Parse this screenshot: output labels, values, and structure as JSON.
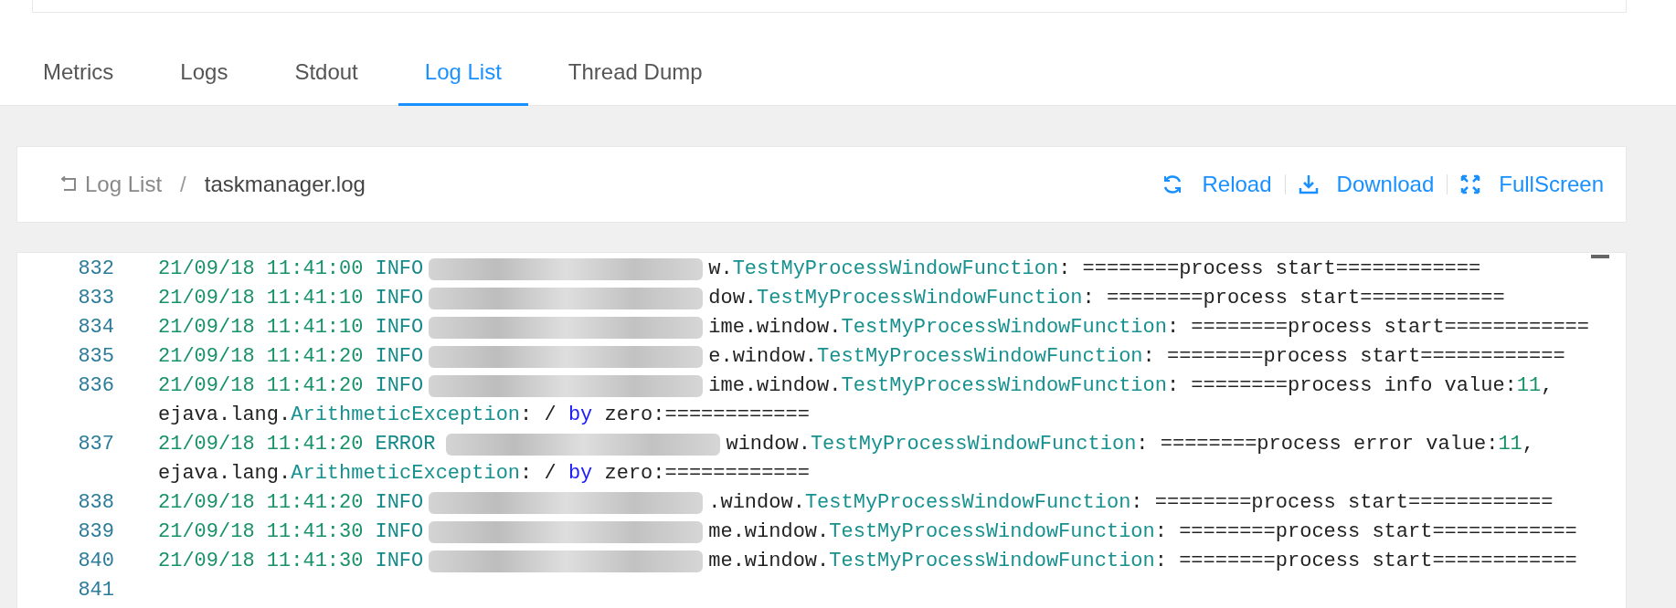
{
  "tabs": [
    {
      "label": "Metrics",
      "selected": false
    },
    {
      "label": "Logs",
      "selected": false
    },
    {
      "label": "Stdout",
      "selected": false
    },
    {
      "label": "Log List",
      "selected": true
    },
    {
      "label": "Thread Dump",
      "selected": false
    }
  ],
  "breadcrumb": {
    "back": "Log List",
    "separator": "/",
    "current": "taskmanager.log"
  },
  "actions": [
    {
      "kind": "reload",
      "label": "Reload"
    },
    {
      "kind": "download",
      "label": "Download"
    },
    {
      "kind": "fullscreen",
      "label": "FullScreen"
    }
  ],
  "log_lines": [
    {
      "number": "832",
      "timestamp": "21/09/18 11:41:00",
      "level": "INFO",
      "source_tail": "w.",
      "class_name": "TestMyProcessWindowFunction",
      "message": ": ========process start============"
    },
    {
      "number": "833",
      "timestamp": "21/09/18 11:41:10",
      "level": "INFO",
      "source_tail": "dow.",
      "class_name": "TestMyProcessWindowFunction",
      "message": ": ========process start============"
    },
    {
      "number": "834",
      "timestamp": "21/09/18 11:41:10",
      "level": "INFO",
      "source_tail": "ime.window.",
      "class_name": "TestMyProcessWindowFunction",
      "message": ": ========process start============"
    },
    {
      "number": "835",
      "timestamp": "21/09/18 11:41:20",
      "level": "INFO",
      "source_tail": "e.window.",
      "class_name": "TestMyProcessWindowFunction",
      "message": ": ========process start============"
    },
    {
      "number": "836",
      "timestamp": "21/09/18 11:41:20",
      "level": "INFO",
      "source_tail": "ime.window.",
      "class_name": "TestMyProcessWindowFunction",
      "message": ": ========process info value:",
      "value": "11",
      "value_tail": ",",
      "continuation": {
        "package": "ejava.lang.",
        "exception": "ArithmeticException",
        "separator": ": / ",
        "keyword": "by",
        "rest": " zero:============"
      }
    },
    {
      "number": "837",
      "timestamp": "21/09/18 11:41:20",
      "level": "ERROR",
      "source_tail": "window.",
      "class_name": "TestMyProcessWindowFunction",
      "message": ": ========process error value:",
      "value": "11",
      "value_tail": ",",
      "continuation": {
        "package": "ejava.lang.",
        "exception": "ArithmeticException",
        "separator": ": / ",
        "keyword": "by",
        "rest": " zero:============"
      }
    },
    {
      "number": "838",
      "timestamp": "21/09/18 11:41:20",
      "level": "INFO",
      "source_tail": ".window.",
      "class_name": "TestMyProcessWindowFunction",
      "message": ": ========process start============"
    },
    {
      "number": "839",
      "timestamp": "21/09/18 11:41:30",
      "level": "INFO",
      "source_tail": "me.window.",
      "class_name": "TestMyProcessWindowFunction",
      "message": ": ========process start============"
    },
    {
      "number": "840",
      "timestamp": "21/09/18 11:41:30",
      "level": "INFO",
      "source_tail": "me.window.",
      "class_name": "TestMyProcessWindowFunction",
      "message": ": ========process start============"
    },
    {
      "number": "841"
    }
  ]
}
